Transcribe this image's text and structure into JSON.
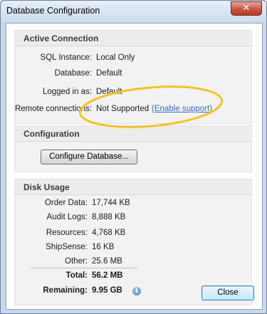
{
  "window": {
    "title": "Database Configuration",
    "close_glyph": "✕"
  },
  "active_connection": {
    "header": "Active Connection",
    "rows": [
      {
        "label": "SQL Instance:",
        "value": "Local Only"
      },
      {
        "label": "Database:",
        "value": "Default"
      },
      {
        "label": "Logged in as:",
        "value": "Default"
      },
      {
        "label": "Remote connections:",
        "value": "Not Supported",
        "link": "(Enable support)"
      }
    ]
  },
  "configuration": {
    "header": "Configuration",
    "button": "Configure Database..."
  },
  "disk_usage": {
    "header": "Disk Usage",
    "rows": [
      {
        "label": "Order Data:",
        "value": "17,744 KB"
      },
      {
        "label": "Audit Logs:",
        "value": "8,888 KB"
      },
      {
        "label": "Resources:",
        "value": "4,768 KB"
      },
      {
        "label": "ShipSense:",
        "value": "16 KB"
      },
      {
        "label": "Other:",
        "value": "25.6 MB"
      }
    ],
    "total": {
      "label": "Total:",
      "value": "56.2 MB"
    },
    "remaining": {
      "label": "Remaining:",
      "value": "9.95 GB"
    }
  },
  "close_button": "Close",
  "icons": {
    "info": "info-icon",
    "close": "close-icon"
  },
  "annotation_color": "#f3c41f"
}
